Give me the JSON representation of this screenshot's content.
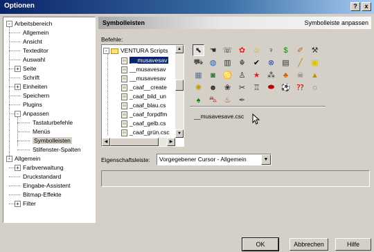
{
  "window": {
    "title": "Optionen",
    "help_btn": "?",
    "close_btn": "x"
  },
  "tree": [
    {
      "label": "Arbeitsbereich",
      "level": 0,
      "exp": "-"
    },
    {
      "label": "Allgemein",
      "level": 1
    },
    {
      "label": "Ansicht",
      "level": 1
    },
    {
      "label": "Texteditor",
      "level": 1
    },
    {
      "label": "Auswahl",
      "level": 1
    },
    {
      "label": "Seite",
      "level": 1,
      "exp": "+"
    },
    {
      "label": "Schrift",
      "level": 1
    },
    {
      "label": "Einheiten",
      "level": 1,
      "exp": "+"
    },
    {
      "label": "Speichern",
      "level": 1
    },
    {
      "label": "Plugins",
      "level": 1
    },
    {
      "label": "Anpassen",
      "level": 1,
      "exp": "-"
    },
    {
      "label": "Tastaturbefehle",
      "level": 2
    },
    {
      "label": "Menüs",
      "level": 2
    },
    {
      "label": "Symbolleisten",
      "level": 2,
      "state": "gray"
    },
    {
      "label": "Stilfenster-Spalten",
      "level": 2
    },
    {
      "label": "Allgemein",
      "level": 0,
      "exp": "-"
    },
    {
      "label": "Farbverwaltung",
      "level": 1,
      "exp": "+"
    },
    {
      "label": "Druckstandard",
      "level": 1
    },
    {
      "label": "Eingabe-Assistent",
      "level": 1
    },
    {
      "label": "Bitmap-Effekte",
      "level": 1
    },
    {
      "label": "Filter",
      "level": 1,
      "exp": "+"
    }
  ],
  "panel": {
    "title": "Symbolleisten",
    "subtitle": "Symbolleiste anpassen"
  },
  "commands": {
    "label": "Befehle:",
    "root": "VENTURA Scripts",
    "items": [
      {
        "label": "__musavesav",
        "state": "selected"
      },
      {
        "label": "__musavesav"
      },
      {
        "label": "__musavesav"
      },
      {
        "label": "_caaf__create"
      },
      {
        "label": "_caaf_bild_un"
      },
      {
        "label": "_caaf_blau.cs"
      },
      {
        "label": "_caaf_forpdfm"
      },
      {
        "label": "_caaf_gelb.cs"
      },
      {
        "label": "_caaf_grün.csc"
      }
    ]
  },
  "icon_grid": [
    [
      "cursor-icon",
      "hand-pointer-icon",
      "dialog-icon",
      "flower-icon",
      "smiley-icon",
      "bulb-icon",
      "dollar-icon",
      "eraser-icon",
      "tools-icon"
    ],
    [
      "cart-icon",
      "globe-icon",
      "trash-icon",
      "people-icon",
      "check-icon",
      "cross-circle-icon",
      "document-icon",
      "pencil-icon",
      "cube-icon"
    ],
    [
      "grid-icon",
      "photo-icon",
      "butterfly-icon",
      "stamp-icon",
      "star-icon",
      "balls-icon",
      "bug-icon",
      "skull-icon",
      "hat-icon"
    ],
    [
      "sun-icon",
      "faces-icon",
      "flower-swirl-icon",
      "scissors-icon",
      "cook-icon",
      "lips-icon",
      "soccer-ball-icon",
      "question-icon",
      "speech-bubble-icon"
    ],
    [
      "tree-icon",
      "car-icon",
      "fire-icon",
      "pen-icon"
    ]
  ],
  "icon_glyphs": {
    "cursor-icon": "⬉",
    "hand-pointer-icon": "☚",
    "dialog-icon": "☏",
    "flower-icon": "✿",
    "smiley-icon": "☺",
    "bulb-icon": "♀",
    "dollar-icon": "$",
    "eraser-icon": "✐",
    "tools-icon": "⚒",
    "cart-icon": "⛟",
    "globe-icon": "◍",
    "trash-icon": "▥",
    "people-icon": "☬",
    "check-icon": "✔",
    "cross-circle-icon": "⊗",
    "document-icon": "▤",
    "pencil-icon": "╱",
    "cube-icon": "▣",
    "grid-icon": "▦",
    "photo-icon": "◙",
    "butterfly-icon": "♋",
    "stamp-icon": "♙",
    "star-icon": "★",
    "balls-icon": "⁂",
    "bug-icon": "♣",
    "skull-icon": "☠",
    "hat-icon": "▲",
    "sun-icon": "✺",
    "faces-icon": "☻",
    "flower-swirl-icon": "❀",
    "scissors-icon": "✂",
    "cook-icon": "♖",
    "lips-icon": "⬬",
    "soccer-ball-icon": "⚽",
    "question-icon": "⁇",
    "speech-bubble-icon": "◌",
    "tree-icon": "♠",
    "car-icon": "⛍",
    "fire-icon": "♨",
    "pen-icon": "✒"
  },
  "icon_colors": {
    "flower-icon": "#e02020",
    "smiley-icon": "#e0b000",
    "dollar-icon": "#208020",
    "eraser-icon": "#c06020",
    "cart-icon": "#505050",
    "globe-icon": "#2060c0",
    "check-icon": "#000000",
    "cross-circle-icon": "#2040c0",
    "pencil-icon": "#c08000",
    "cube-icon": "#e0c000",
    "butterfly-icon": "#4060c0",
    "star-icon": "#e02020",
    "bug-icon": "#d06000",
    "skull-icon": "#606060",
    "hat-icon": "#c09000",
    "sun-icon": "#c0a000",
    "lips-icon": "#c00000",
    "question-icon": "#c00000",
    "tree-icon": "#108010",
    "car-icon": "#c02020",
    "fire-icon": "#e04000",
    "pen-icon": "#606060",
    "photo-icon": "#307030",
    "grid-icon": "#607090"
  },
  "selected_command": "__musavesave.csc",
  "property": {
    "label": "Eigenschaftsleiste:",
    "value": "Vorgegebener Cursor - Allgemein"
  },
  "buttons": {
    "ok": "OK",
    "cancel": "Abbrechen",
    "help": "Hilfe"
  },
  "colors": {
    "title_bar": "#0a246a",
    "selection": "#0a246a",
    "face": "#d4d0c8"
  }
}
